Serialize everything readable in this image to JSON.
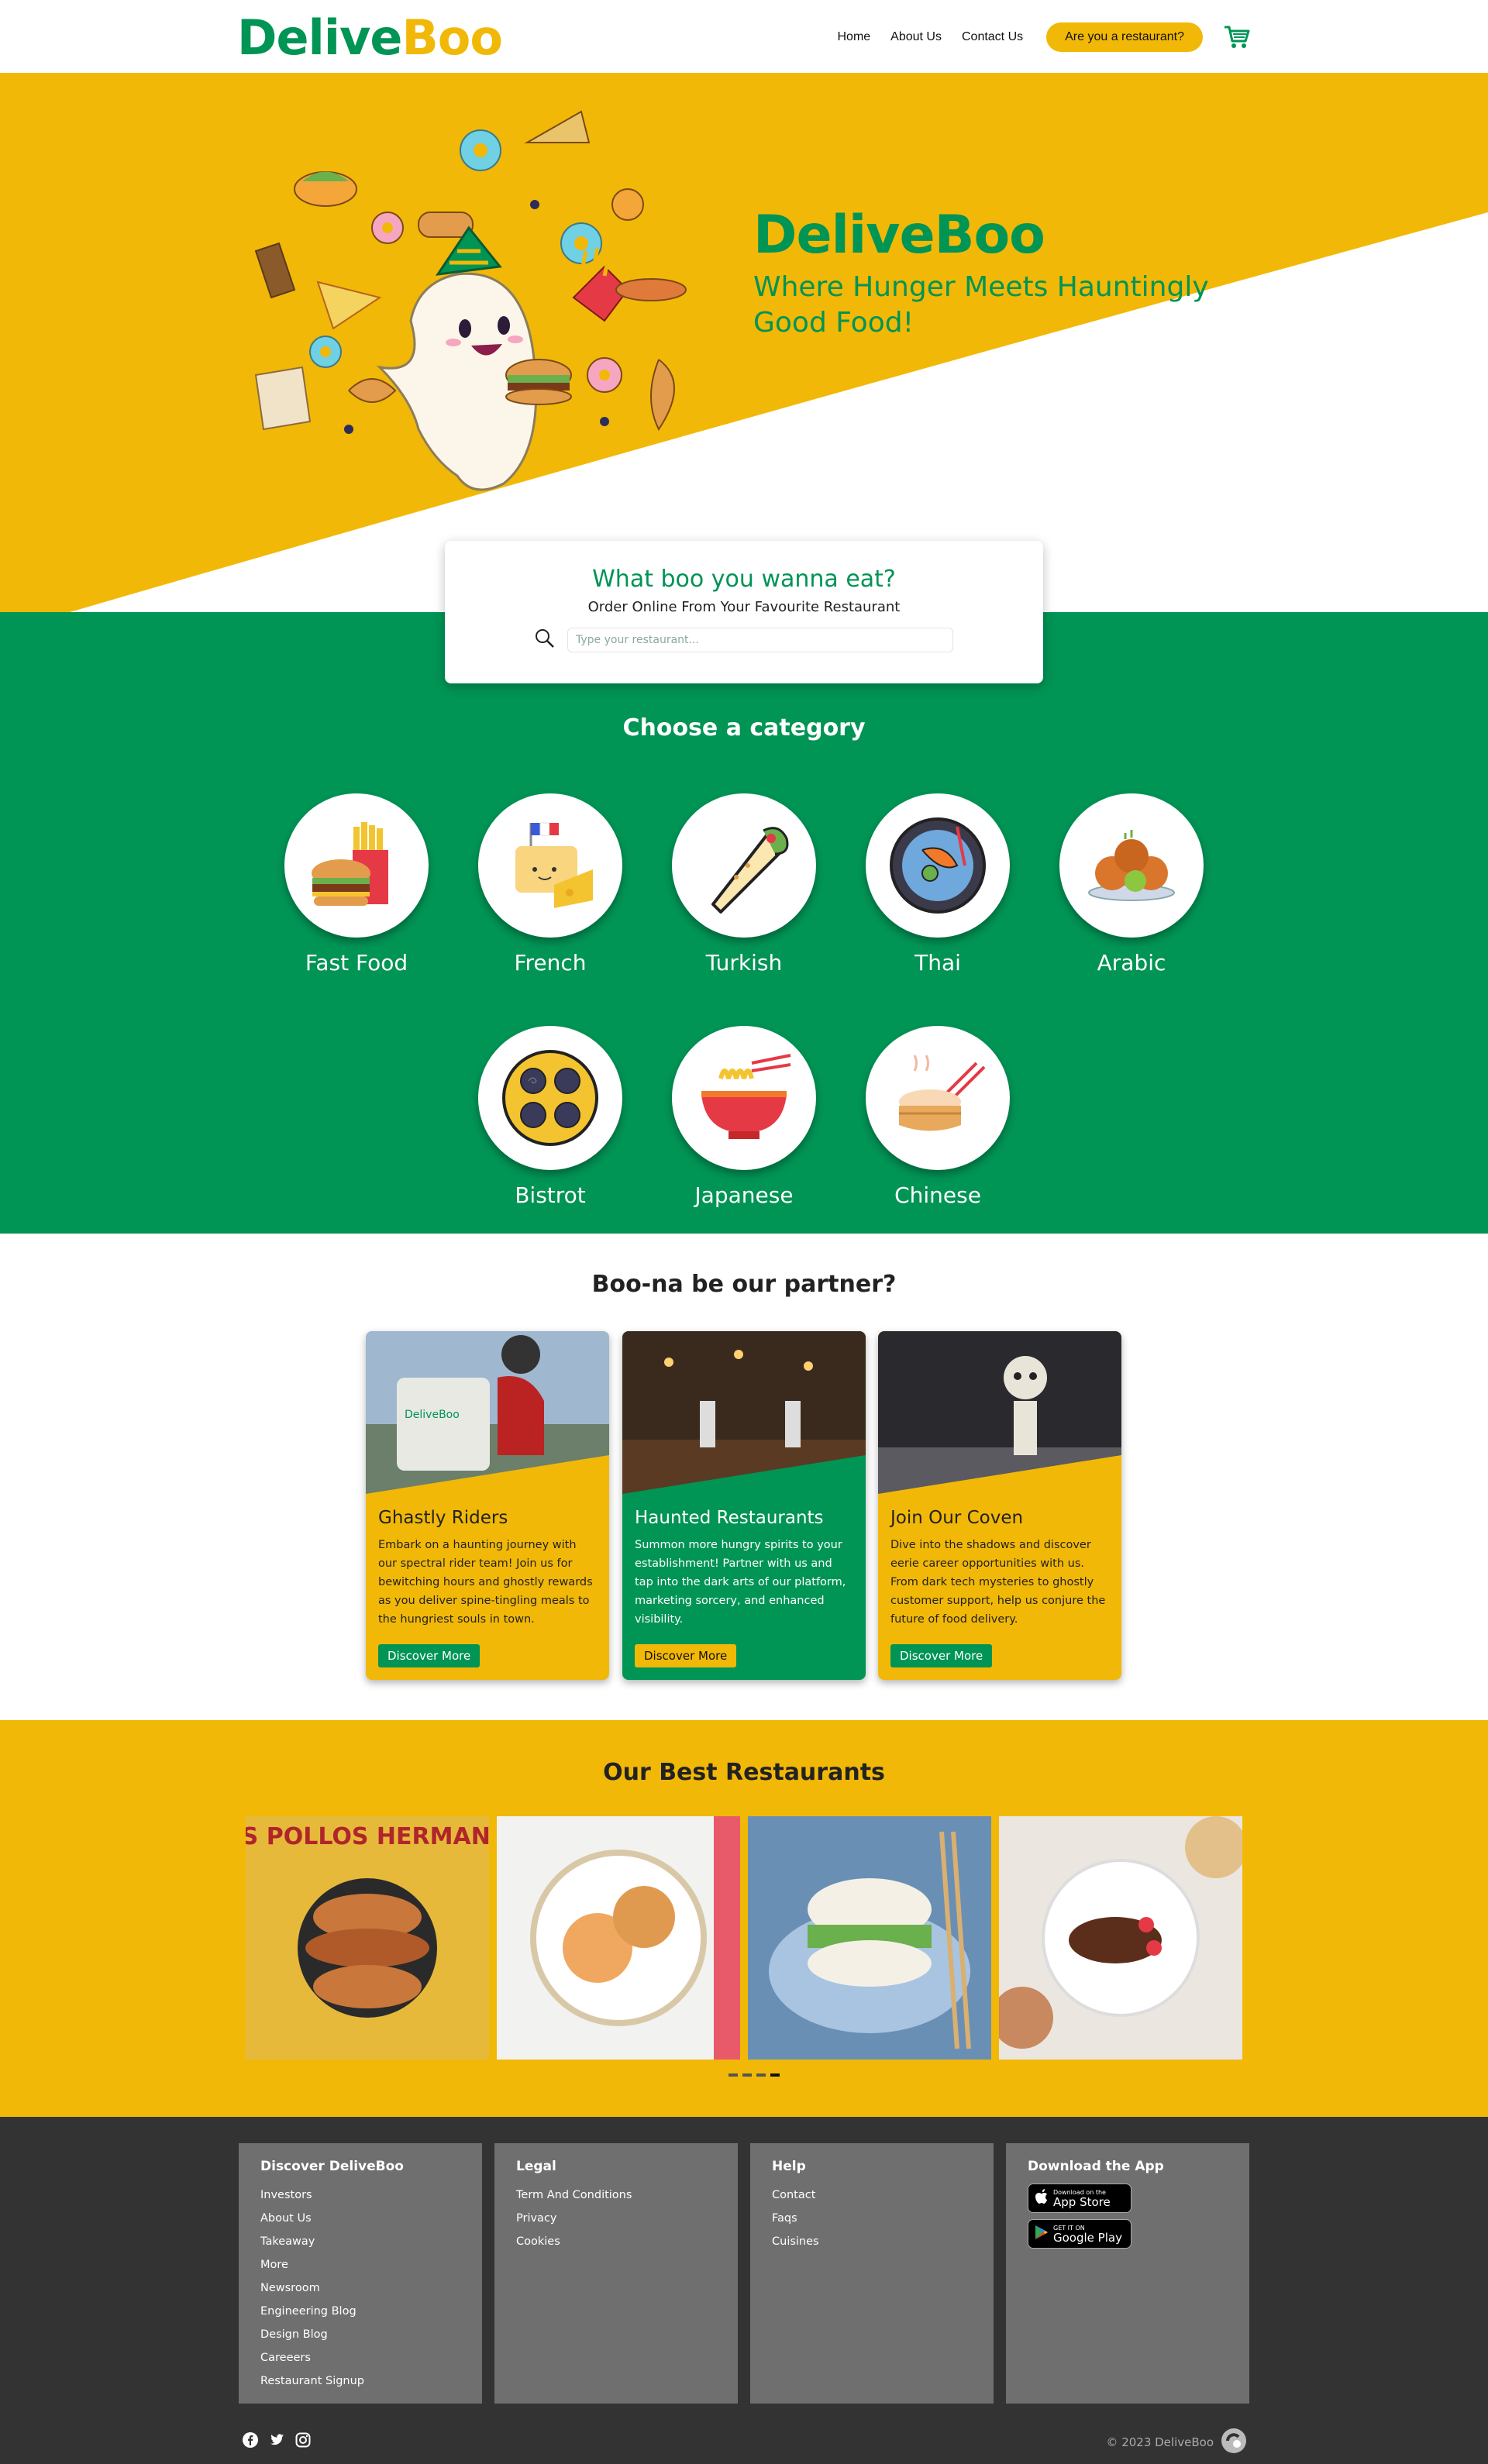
{
  "header": {
    "logo_part1": "Delive",
    "logo_part2": "Boo",
    "nav": [
      "Home",
      "About Us",
      "Contact Us"
    ],
    "restaurant_button": "Are you a restaurant?",
    "cart_icon": "cart-icon"
  },
  "hero": {
    "title": "DeliveBoo",
    "subtitle": "Where Hunger Meets Hauntingly Good Food!"
  },
  "search": {
    "title": "What boo you wanna eat?",
    "subtitle": "Order Online From Your Favourite Restaurant",
    "placeholder": "Type your restaurant...",
    "icon": "search-icon"
  },
  "categories": {
    "title": "Choose a category",
    "items": [
      "Fast Food",
      "French",
      "Turkish",
      "Thai",
      "Arabic",
      "Bistrot",
      "Japanese",
      "Chinese"
    ]
  },
  "partners": {
    "title": "Boo-na be our partner?",
    "cards": [
      {
        "title": "Ghastly Riders",
        "text": "Embark on a haunting journey with our spectral rider team! Join us for bewitching hours and ghostly rewards as you deliver spine-tingling meals to the hungriest souls in town.",
        "button": "Discover More"
      },
      {
        "title": "Haunted Restaurants",
        "text": "Summon more hungry spirits to your establishment! Partner with us and tap into the dark arts of our platform, marketing sorcery, and enhanced visibility.",
        "button": "Discover More"
      },
      {
        "title": "Join Our Coven",
        "text": "Dive into the shadows and discover eerie career opportunities with us. From dark tech mysteries to ghostly customer support, help us conjure the future of food delivery.",
        "button": "Discover More"
      }
    ]
  },
  "restaurants": {
    "title": "Our Best Restaurants",
    "image_text": "LOS POLLOS HERMANOS"
  },
  "footer": {
    "columns": [
      {
        "title": "Discover DeliveBoo",
        "links": [
          "Investors",
          "About Us",
          "Takeaway",
          "More",
          "Newsroom",
          "Engineering Blog",
          "Design Blog",
          "Careeers",
          "Restaurant Signup"
        ]
      },
      {
        "title": "Legal",
        "links": [
          "Term And Conditions",
          "Privacy",
          "Cookies"
        ]
      },
      {
        "title": "Help",
        "links": [
          "Contact",
          "Faqs",
          "Cuisines"
        ]
      },
      {
        "title": "Download the App",
        "links": []
      }
    ],
    "app_store": {
      "small": "Download on the",
      "big": "App Store"
    },
    "google_play": {
      "small": "GET IT ON",
      "big": "Google Play"
    },
    "copyright": "© 2023 DeliveBoo"
  },
  "colors": {
    "green": "#009455",
    "yellow": "#f2b807",
    "dark": "#333333",
    "footer_col": "#6f6f6f"
  }
}
